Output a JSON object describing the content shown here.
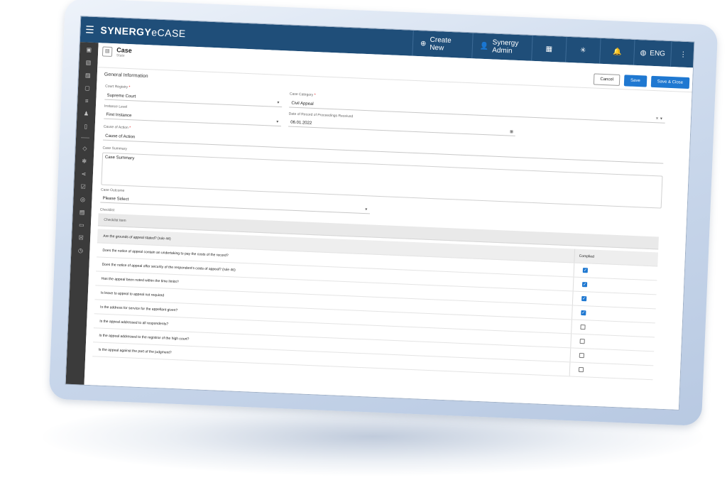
{
  "app": {
    "brand_strong": "SYNERGY",
    "brand_light": "eCASE",
    "create_new": "Create New",
    "user": "Synergy Admin",
    "language": "ENG"
  },
  "page": {
    "title": "Case",
    "subtitle": "State",
    "cancel": "Cancel",
    "save": "Save",
    "save_close": "Save & Close"
  },
  "form": {
    "section_title": "General Information",
    "court_registry_label": "Court Registry",
    "court_registry_value": "Supreme Court",
    "case_category_label": "Case Category",
    "case_category_value": "Civil Appeal",
    "instance_level_label": "Instance Level",
    "instance_level_value": "First Instance",
    "date_label": "Date of Record of Proceedings Received",
    "date_value": "06.01.2022",
    "cause_label": "Cause of Action",
    "cause_value": "Cause of Action",
    "summary_label": "Case Summary",
    "summary_value": "Case Summary",
    "outcome_label": "Case Outcome",
    "outcome_value": "Please Select",
    "checklist_label": "Checklist"
  },
  "checklist": {
    "header_item": "Checklist Item",
    "header_compliant": "Complied",
    "items": [
      {
        "text": "Are the grounds of appeal stated? (rule 44)",
        "checked": null
      },
      {
        "text": "Does the notice of appeal contain an undertaking to pay the costs of the record?",
        "checked": true
      },
      {
        "text": "Does the notice of appeal offer security of the respondent's costs of appeal? (rule 46)",
        "checked": true
      },
      {
        "text": "Has the appeal been noted within the time limits?",
        "checked": true
      },
      {
        "text": "Is leave to appeal to appeal not required",
        "checked": true
      },
      {
        "text": "Is the address for service for the appellant given?",
        "checked": false
      },
      {
        "text": "Is the appeal addressed to all respondents?",
        "checked": false
      },
      {
        "text": "Is the appeal addressed to the registrar of the high court?",
        "checked": false
      },
      {
        "text": "Is the appeal against the part of the judgment?",
        "checked": false
      }
    ]
  }
}
